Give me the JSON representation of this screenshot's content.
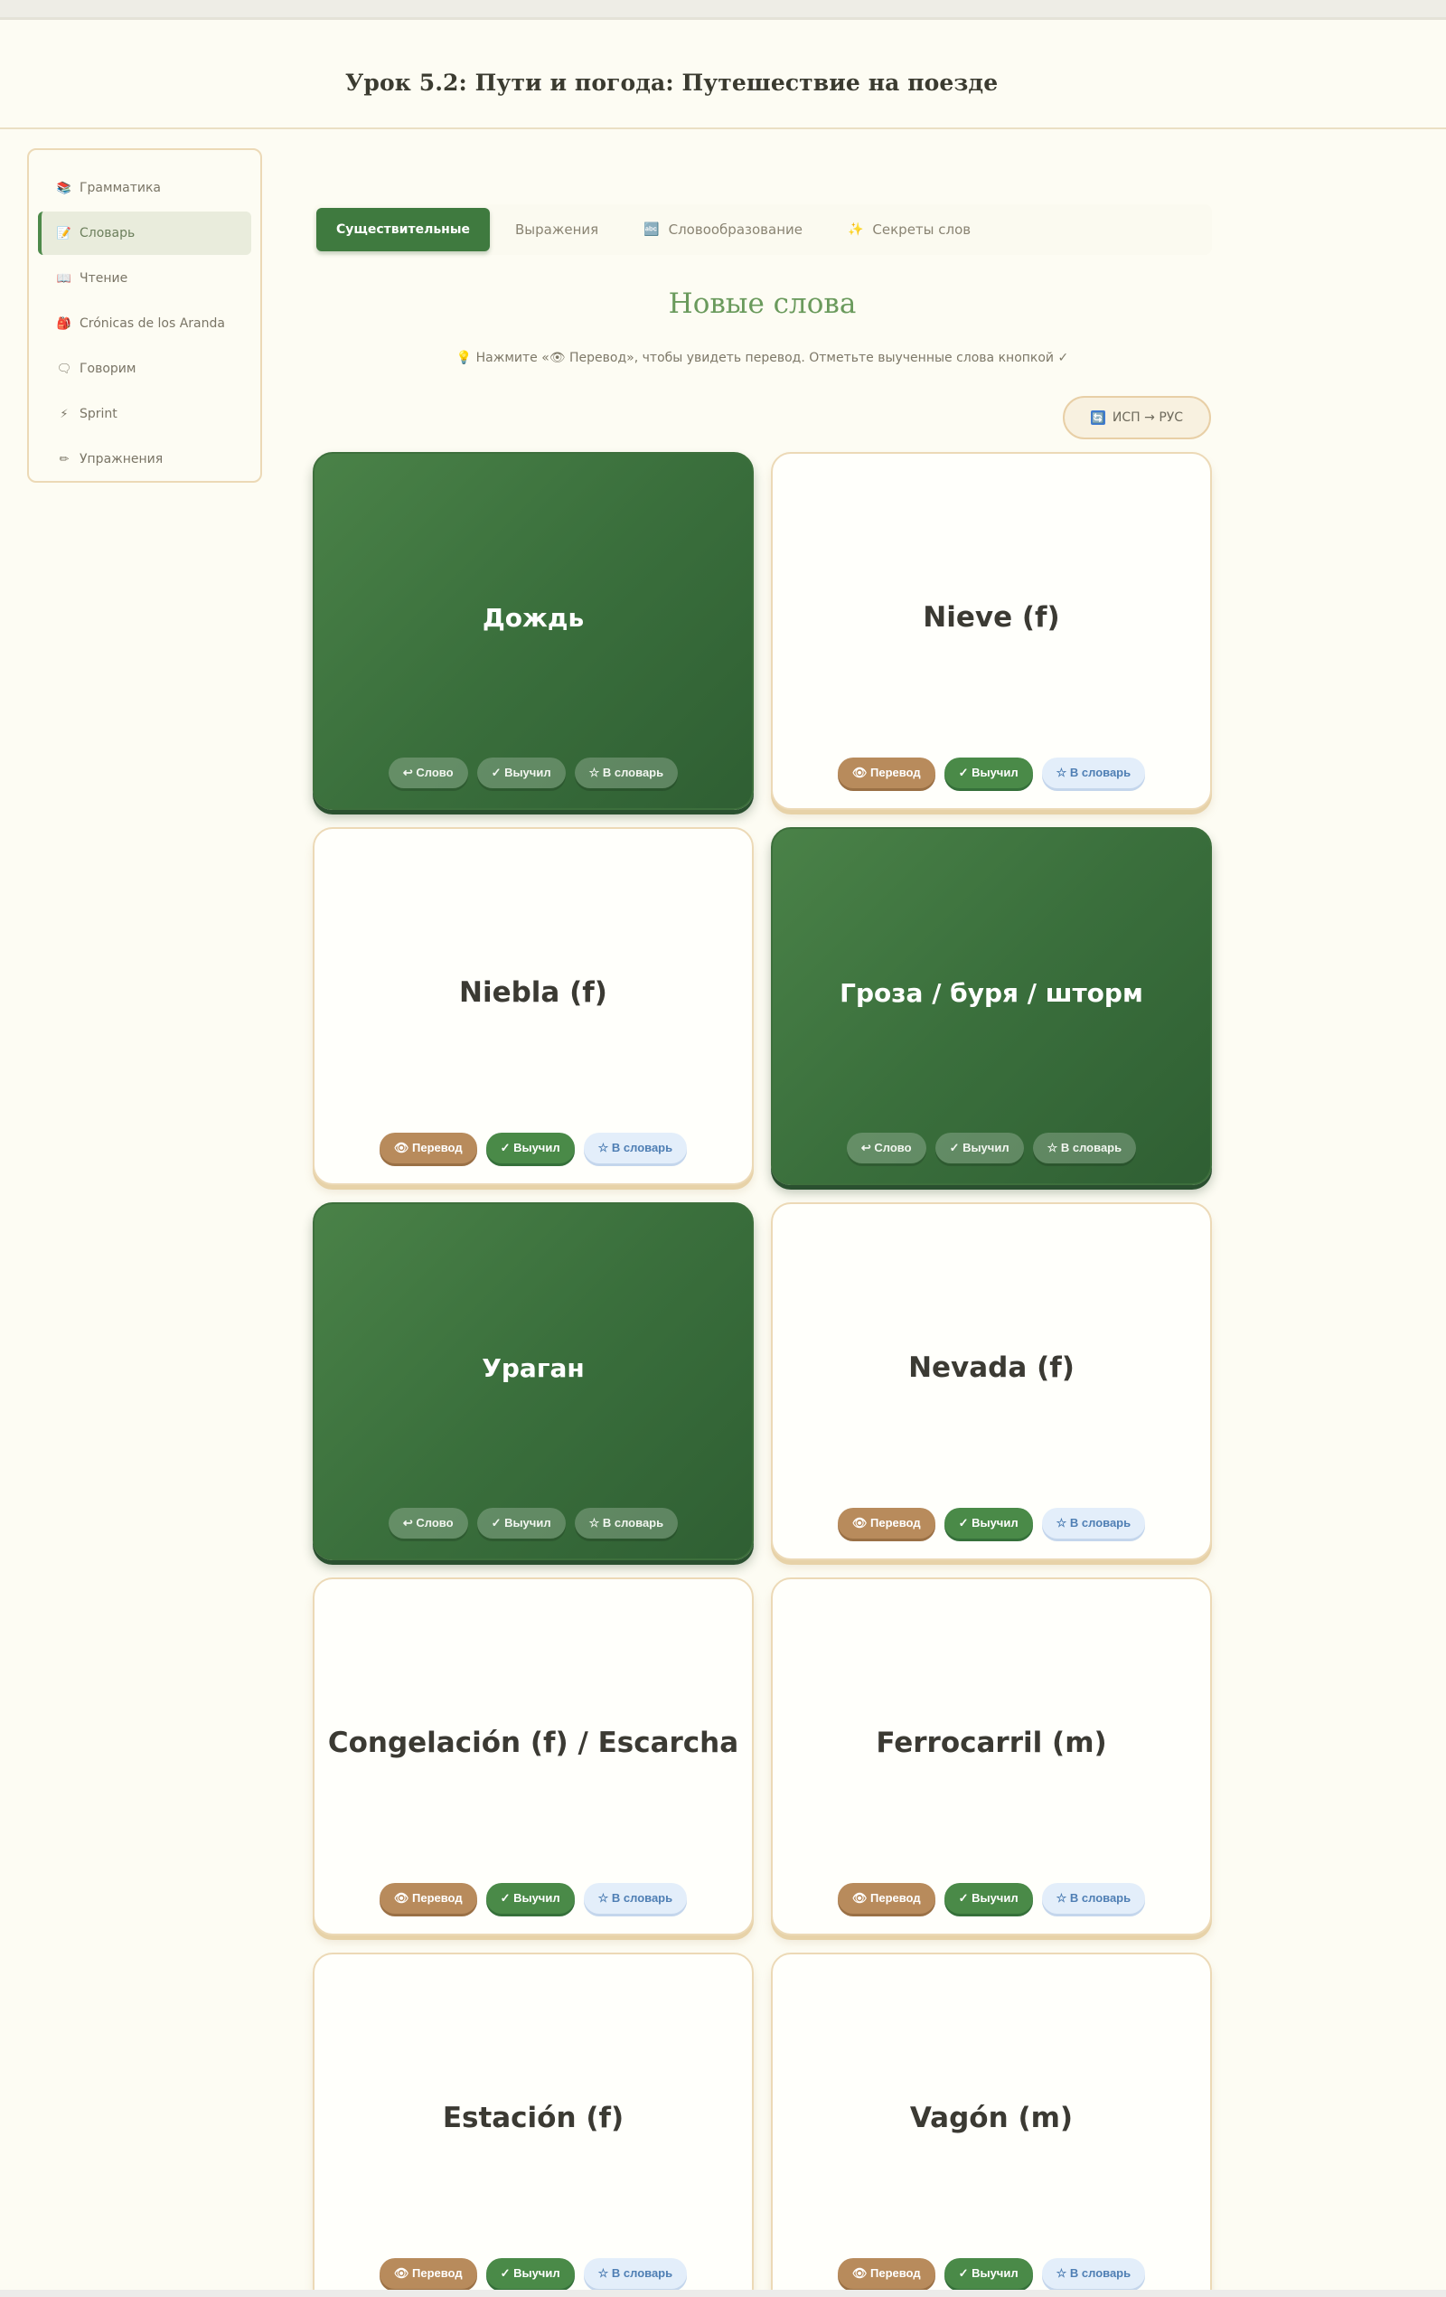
{
  "header": {
    "title": "Урок 5.2: Пути и погода: Путешествие на поезде"
  },
  "sidebar": {
    "items": [
      {
        "icon": "📚",
        "label": "Грамматика"
      },
      {
        "icon": "📝",
        "label": "Словарь"
      },
      {
        "icon": "📖",
        "label": "Чтение"
      },
      {
        "icon": "🎒",
        "label": "Crónicas de los Aranda"
      },
      {
        "icon": "🗨",
        "label": "Говорим"
      },
      {
        "icon": "⚡",
        "label": "Sprint"
      },
      {
        "icon": "✏",
        "label": "Упражнения"
      }
    ]
  },
  "tabs": [
    {
      "label": "Существительные",
      "icon": ""
    },
    {
      "label": "Выражения",
      "icon": ""
    },
    {
      "label": "Словообразование",
      "icon": "🔤"
    },
    {
      "label": "Секреты слов",
      "icon": "✨"
    }
  ],
  "section": {
    "title": "Новые слова",
    "hint": "💡 Нажмите «👁 Перевод», чтобы увидеть перевод. Отметьте выученные слова кнопкой ✓"
  },
  "lang_toggle": {
    "icon": "🔄",
    "label": "ИСП → РУС"
  },
  "buttons": {
    "translate": "👁 Перевод",
    "word": "↩ Слово",
    "learned": "✓ Выучил",
    "dict": "☆ В словарь"
  },
  "cards": [
    {
      "word": "Дождь",
      "flipped": true
    },
    {
      "word": "Nieve (f)",
      "flipped": false
    },
    {
      "word": "Niebla (f)",
      "flipped": false
    },
    {
      "word": "Гроза / буря / шторм",
      "flipped": true
    },
    {
      "word": "Ураган",
      "flipped": true
    },
    {
      "word": "Nevada (f)",
      "flipped": false
    },
    {
      "word": "Congelación (f) / Escarcha",
      "flipped": false
    },
    {
      "word": "Ferrocarril (m)",
      "flipped": false
    },
    {
      "word": "Estación (f)",
      "flipped": false
    },
    {
      "word": "Vagón (m)",
      "flipped": false
    }
  ]
}
